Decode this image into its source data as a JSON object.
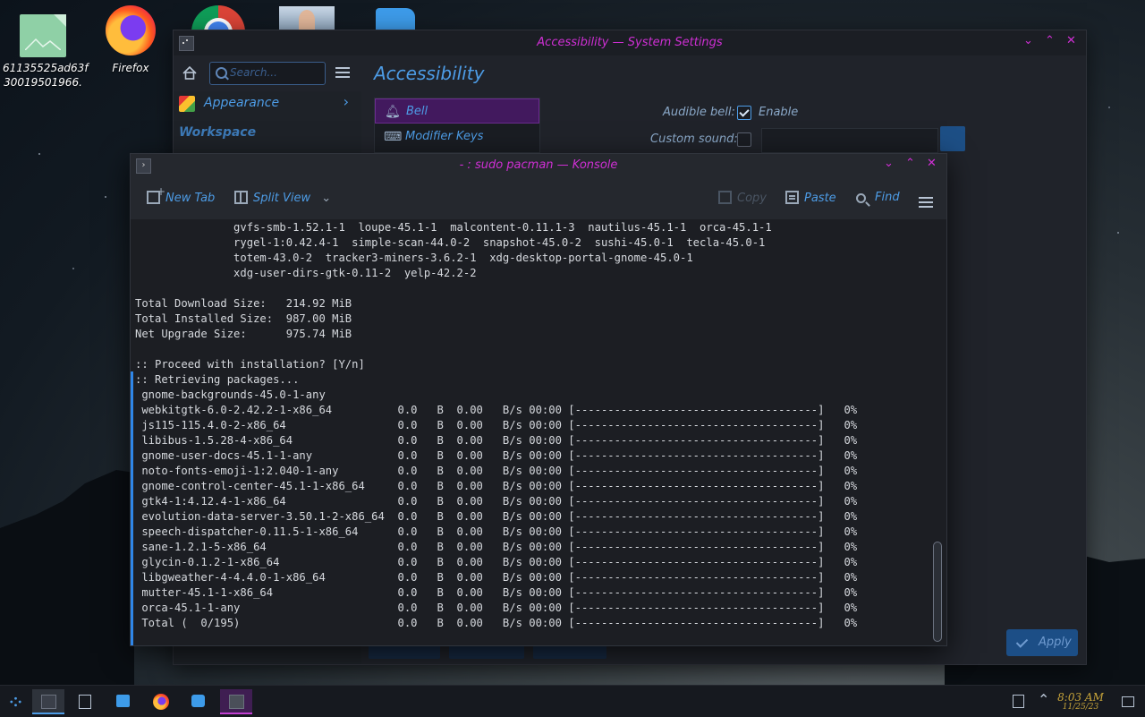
{
  "desktop": {
    "icons": [
      {
        "label_line1": "61135525ad63f",
        "label_line2": "30019501966."
      },
      {
        "label_line1": "Firefox"
      }
    ]
  },
  "settings": {
    "title": "Accessibility — System Settings",
    "search_placeholder": "Search...",
    "page_title": "Accessibility",
    "sidebar": {
      "appearance": "Appearance",
      "workspace_heading": "Workspace"
    },
    "categories": [
      "Bell",
      "Modifier Keys"
    ],
    "audible_bell_label": "Audible bell:",
    "audible_bell_value": "Enable",
    "audible_bell_checked": true,
    "custom_sound_label": "Custom sound:",
    "custom_sound_checked": false,
    "apply_label": "Apply"
  },
  "konsole": {
    "title": "- : sudo pacman — Konsole",
    "toolbar": {
      "new_tab": "New Tab",
      "split_view": "Split View",
      "copy": "Copy",
      "paste": "Paste",
      "find": "Find"
    },
    "lines": [
      "               gvfs-smb-1.52.1-1  loupe-45.1-1  malcontent-0.11.1-3  nautilus-45.1-1  orca-45.1-1",
      "               rygel-1:0.42.4-1  simple-scan-44.0-2  snapshot-45.0-2  sushi-45.0-1  tecla-45.0-1",
      "               totem-43.0-2  tracker3-miners-3.6.2-1  xdg-desktop-portal-gnome-45.0-1",
      "               xdg-user-dirs-gtk-0.11-2  yelp-42.2-2",
      "",
      "Total Download Size:   214.92 MiB",
      "Total Installed Size:  987.00 MiB",
      "Net Upgrade Size:      975.74 MiB",
      "",
      ":: Proceed with installation? [Y/n]",
      ":: Retrieving packages...",
      " gnome-backgrounds-45.0-1-any",
      " webkitgtk-6.0-2.42.2-1-x86_64          0.0   B  0.00   B/s 00:00 [-------------------------------------]   0%",
      " js115-115.4.0-2-x86_64                 0.0   B  0.00   B/s 00:00 [-------------------------------------]   0%",
      " libibus-1.5.28-4-x86_64                0.0   B  0.00   B/s 00:00 [-------------------------------------]   0%",
      " gnome-user-docs-45.1-1-any             0.0   B  0.00   B/s 00:00 [-------------------------------------]   0%",
      " noto-fonts-emoji-1:2.040-1-any         0.0   B  0.00   B/s 00:00 [-------------------------------------]   0%",
      " gnome-control-center-45.1-1-x86_64     0.0   B  0.00   B/s 00:00 [-------------------------------------]   0%",
      " gtk4-1:4.12.4-1-x86_64                 0.0   B  0.00   B/s 00:00 [-------------------------------------]   0%",
      " evolution-data-server-3.50.1-2-x86_64  0.0   B  0.00   B/s 00:00 [-------------------------------------]   0%",
      " speech-dispatcher-0.11.5-1-x86_64      0.0   B  0.00   B/s 00:00 [-------------------------------------]   0%",
      " sane-1.2.1-5-x86_64                    0.0   B  0.00   B/s 00:00 [-------------------------------------]   0%",
      " glycin-0.1.2-1-x86_64                  0.0   B  0.00   B/s 00:00 [-------------------------------------]   0%",
      " libgweather-4-4.4.0-1-x86_64           0.0   B  0.00   B/s 00:00 [-------------------------------------]   0%",
      " mutter-45.1-1-x86_64                   0.0   B  0.00   B/s 00:00 [-------------------------------------]   0%",
      " orca-45.1-1-any                        0.0   B  0.00   B/s 00:00 [-------------------------------------]   0%",
      " Total (  0/195)                        0.0   B  0.00   B/s 00:00 [-------------------------------------]   0%"
    ]
  },
  "taskbar": {
    "time": "8:03 AM",
    "date": "11/25/23"
  },
  "colors": {
    "accent": "#4d9ce6",
    "title_magenta": "#cf2fd4",
    "selection": "#42195e",
    "clock": "#c7a43a"
  }
}
